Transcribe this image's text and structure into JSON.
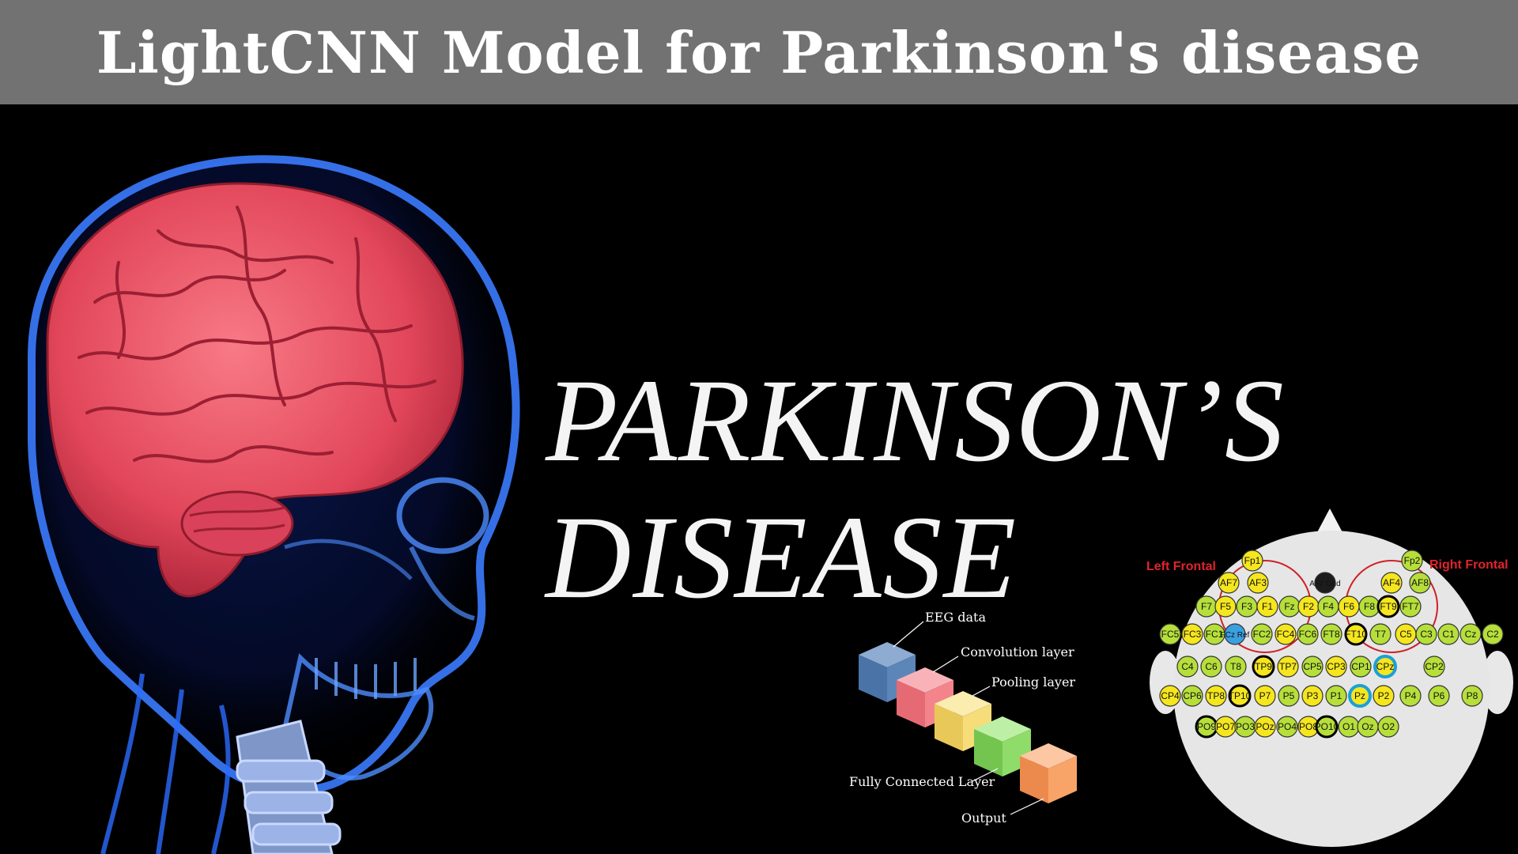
{
  "header": {
    "title": "LightCNN Model for Parkinson's disease"
  },
  "headline": {
    "line1": "PARKINSON’S",
    "line2": "DISEASE"
  },
  "illustration": {
    "subject": "brain-skull-xray",
    "brain_color": "#e8485e",
    "skull_color": "#2a6cff"
  },
  "cnn_diagram": {
    "labels": {
      "eeg_data": "EEG data",
      "convolution": "Convolution layer",
      "pooling": "Pooling layer",
      "fully_connected": "Fully Connected Layer",
      "output": "Output"
    },
    "block_colors": [
      "#5c86b8",
      "#f4848c",
      "#f6dd7a",
      "#8fdc6a",
      "#f8a468"
    ]
  },
  "eeg_map": {
    "left_label": "Left Frontal",
    "right_label": "Right Frontal",
    "electrodes": [
      "Fp1",
      "Fp2",
      "AF7",
      "AF3",
      "AFz Gnd",
      "AF4",
      "AF8",
      "F7",
      "F5",
      "F3",
      "F1",
      "Fz",
      "F2",
      "F4",
      "F6",
      "F8",
      "FT9",
      "FT7",
      "FC5",
      "FC3",
      "FC1",
      "FCz Ref",
      "FC2",
      "FC4",
      "FC6",
      "FT8",
      "FT10",
      "T7",
      "C5",
      "C3",
      "C1",
      "Cz",
      "C2",
      "C4",
      "C6",
      "T8",
      "TP9",
      "TP7",
      "CP5",
      "CP3",
      "CP1",
      "CPz",
      "CP2",
      "CP4",
      "CP6",
      "TP8",
      "TP10",
      "P7",
      "P5",
      "P3",
      "P1",
      "Pz",
      "P2",
      "P4",
      "P6",
      "P8",
      "PO9",
      "PO7",
      "PO3",
      "POz",
      "PO4",
      "PO8",
      "PO10",
      "O1",
      "Oz",
      "O2"
    ]
  }
}
